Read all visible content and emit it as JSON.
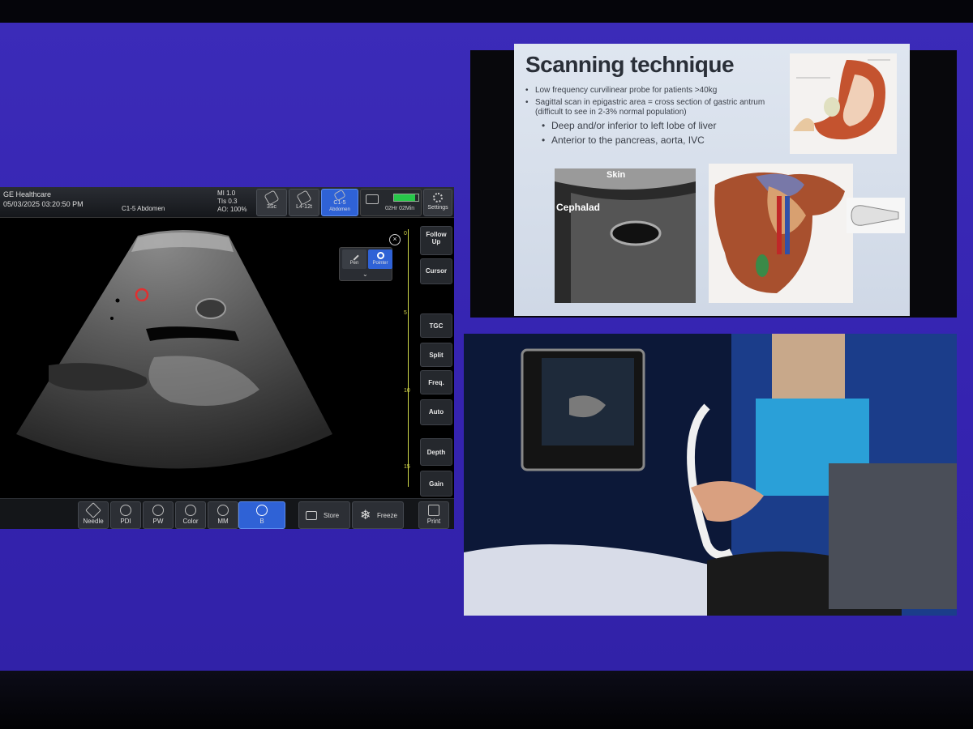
{
  "ultrasound": {
    "brand": "GE Healthcare",
    "datetime": "05/03/2025 03:20:50 PM",
    "probe_preset": "C1-5  Abdomen",
    "params": [
      "MI 1.0",
      "TIs 0.3",
      "AO: 100%"
    ],
    "probe_buttons": [
      {
        "label": "3Sc",
        "active": false
      },
      {
        "label": "L4-12t",
        "active": false
      },
      {
        "label": "C1-5",
        "sub": "Abdomen",
        "active": true
      }
    ],
    "battery": {
      "text": "02Hr 02Min",
      "level": 0.85,
      "color": "#27c84a"
    },
    "settings_label": "Settings",
    "close_label": "×",
    "pointer_buttons": [
      {
        "label": "Pen",
        "active": false
      },
      {
        "label": "Pointer",
        "active": true
      }
    ],
    "depth_labels": [
      "0",
      "5",
      "10",
      "15"
    ],
    "side_buttons": [
      "Follow Up",
      "Cursor",
      "TGC",
      "Split",
      "Freq.",
      "Auto",
      "Depth",
      "Gain"
    ],
    "mode_buttons": [
      {
        "label": "Needle",
        "active": false
      },
      {
        "label": "PDI",
        "active": false
      },
      {
        "label": "PW",
        "active": false
      },
      {
        "label": "Color",
        "active": false
      },
      {
        "label": "MM",
        "active": false
      },
      {
        "label": "B",
        "active": true
      }
    ],
    "store_label": "Store",
    "freeze_label": "Freeze",
    "print_label": "Print",
    "accent": "#2f62d6"
  },
  "slide": {
    "title": "Scanning technique",
    "bullets": [
      {
        "text": "Low frequency curvilinear probe for patients >40kg",
        "sub": false
      },
      {
        "text": "Sagittal scan in epigastric area = cross section of gastric antrum (difficult to see in  2-3% normal population)",
        "sub": false
      },
      {
        "text": "Deep and/or inferior to left lobe of liver",
        "sub": true
      },
      {
        "text": "Anterior to the pancreas, aorta, IVC",
        "sub": true
      }
    ],
    "skin_label": "Skin",
    "cephalad_label": "Cephalad"
  }
}
